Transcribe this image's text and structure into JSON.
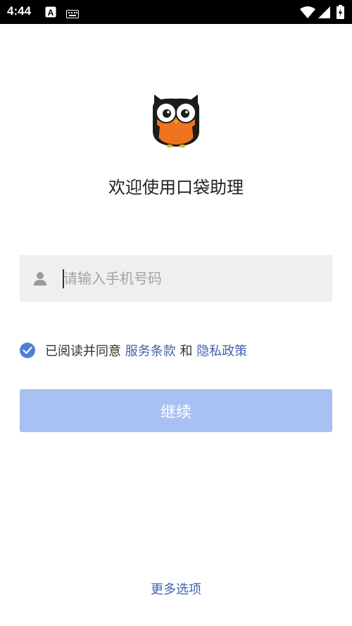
{
  "status_bar": {
    "time": "4:44",
    "icons": [
      "a-notification-icon",
      "keyboard-icon",
      "wifi-icon",
      "signal-icon",
      "battery-icon"
    ]
  },
  "logo": {
    "icon": "owl-logo"
  },
  "welcome_text": "欢迎使用口袋助理",
  "phone_input": {
    "placeholder": "请输入手机号码",
    "value": "",
    "icon": "user-icon"
  },
  "agreement": {
    "checked": true,
    "prefix": "已阅读并同意 ",
    "terms_link": "服务条款",
    "conjunction": " 和 ",
    "privacy_link": "隐私政策"
  },
  "continue_button": {
    "label": "继续",
    "enabled": false
  },
  "more_options": "更多选项",
  "colors": {
    "accent": "#4e7ed6",
    "link": "#3f64ad",
    "button_disabled": "#a8c1f3",
    "input_bg": "#efefef",
    "owl_orange": "#f0731e"
  }
}
